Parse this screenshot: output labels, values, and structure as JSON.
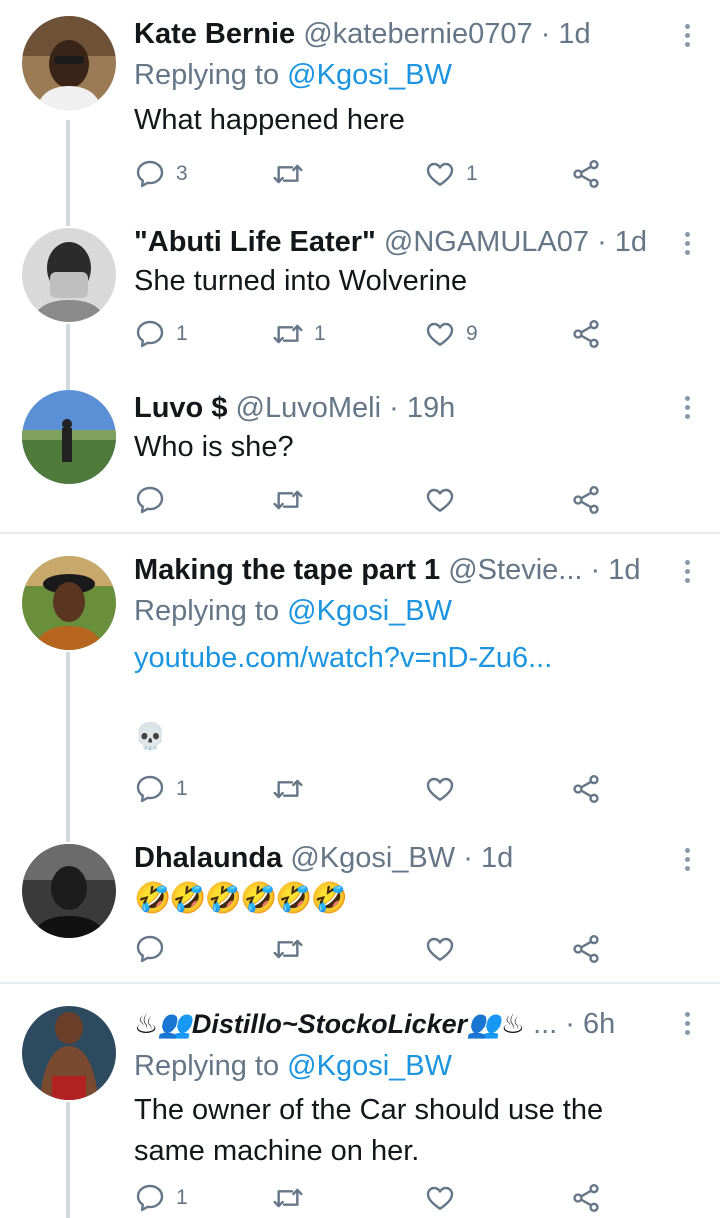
{
  "tweets": [
    {
      "name": "Kate Bernie",
      "handle": "@katebernie0707",
      "time": "1d",
      "reply_prefix": "Replying to",
      "reply_to": "@Kgosi_BW",
      "text": "What happened here",
      "replies": "3",
      "retweets": "",
      "likes": "1"
    },
    {
      "name": "\"Abuti Life Eater\"",
      "handle": "@NGAMULA07",
      "time": "1d",
      "text": "She turned into Wolverine",
      "replies": "1",
      "retweets": "1",
      "likes": "9"
    },
    {
      "name": "Luvo $",
      "handle": "@LuvoMeli",
      "time": "19h",
      "text": "Who is she?",
      "replies": "",
      "retweets": "",
      "likes": ""
    },
    {
      "name": "Making the tape part 1",
      "handle": "@Stevie...",
      "time": "1d",
      "reply_prefix": "Replying to",
      "reply_to": "@Kgosi_BW",
      "link": "youtube.com/watch?v=nD-Zu6...",
      "emoji": "💀",
      "replies": "1",
      "retweets": "",
      "likes": ""
    },
    {
      "name": "Dhalaunda",
      "handle": "@Kgosi_BW",
      "time": "1d",
      "emoji": "🤣🤣🤣🤣🤣🤣",
      "replies": "",
      "retweets": "",
      "likes": ""
    },
    {
      "name": "♨👥Distillo~StockoLicker👥♨",
      "handle": "...",
      "time": "6h",
      "reply_prefix": "Replying to",
      "reply_to": "@Kgosi_BW",
      "text": "The owner of the Car should use the same machine on her.",
      "replies": "1",
      "retweets": "",
      "likes": ""
    }
  ],
  "separator": "·",
  "colors": {
    "accent": "#1b95e0",
    "muted": "#657786",
    "icon": "#657786",
    "divider": "#e6ecf0"
  },
  "icons": [
    "reply-icon",
    "retweet-icon",
    "like-icon",
    "share-icon",
    "more-icon"
  ]
}
